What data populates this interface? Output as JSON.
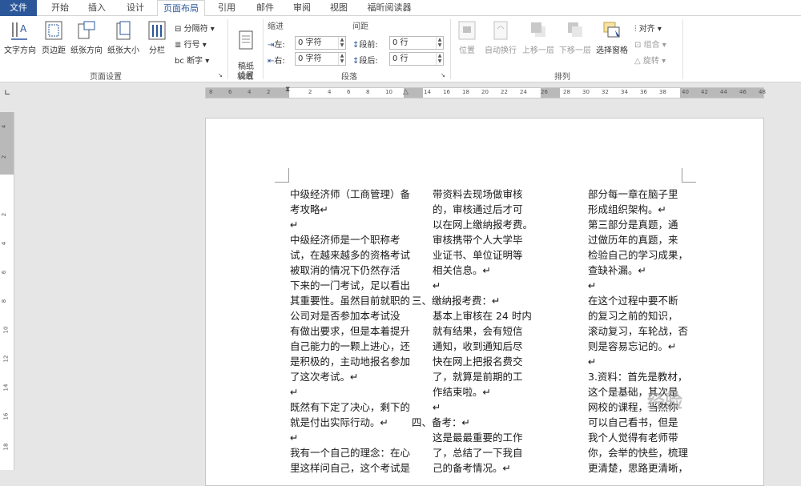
{
  "tabs": [
    "文件",
    "开始",
    "插入",
    "设计",
    "页面布局",
    "引用",
    "邮件",
    "审阅",
    "视图",
    "福昕阅读器"
  ],
  "ribbon": {
    "page_setup": {
      "text_direction": "文字方向",
      "margins": "页边距",
      "orientation": "纸张方向",
      "size": "纸张大小",
      "columns": "分栏",
      "breaks": "分隔符",
      "line_numbers": "行号",
      "hyphenation": "断字",
      "group_label": "页面设置"
    },
    "manuscript": {
      "label": "稿纸\n设置",
      "group_label": "稿纸"
    },
    "paragraph": {
      "indent_title": "缩进",
      "spacing_title": "间距",
      "left_label": "左:",
      "left_value": "0 字符",
      "right_label": "右:",
      "right_value": "0 字符",
      "before_label": "段前:",
      "before_value": "0 行",
      "after_label": "段后:",
      "after_value": "0 行",
      "group_label": "段落"
    },
    "arrange": {
      "position": "位置",
      "wrap_text": "自动换行",
      "bring_forward": "上移一层",
      "send_backward": "下移一层",
      "selection_pane": "选择窗格",
      "align": "对齐",
      "group": "组合",
      "rotate": "旋转",
      "group_label": "排列"
    }
  },
  "ruler_ticks": [
    "8",
    "6",
    "4",
    "2",
    "2",
    "4",
    "6",
    "8",
    "10",
    "14",
    "16",
    "18",
    "20",
    "22",
    "24",
    "26",
    "28",
    "30",
    "32",
    "34",
    "36",
    "38",
    "40",
    "42",
    "44",
    "46",
    "48"
  ],
  "vruler_ticks": [
    "4",
    "2",
    "2",
    "4",
    "6",
    "8",
    "10",
    "12",
    "14",
    "16",
    "18"
  ],
  "document": {
    "col1": [
      "中级经济师（工商管理）备",
      "考攻略↵",
      "↵",
      "中级经济师是一个职称考",
      "试，在越来越多的资格考试",
      "被取消的情况下仍然存活",
      "下来的一门考试，足以看出",
      "其重要性。虽然目前就职的",
      "公司对是否参加本考试没",
      "有做出要求，但是本着提升",
      "自己能力的一颗上进心，还",
      "是积极的，主动地报名参加",
      "了这次考试。↵",
      "↵",
      "既然有下定了决心，剩下的",
      "就是付出实际行动。↵",
      "↵",
      "我有一个自己的理念：在心",
      "里这样问自己，这个考试是"
    ],
    "col2": [
      "带资料去现场做审核",
      "的，审核通过后才可",
      "以在网上缴纳报考费。",
      "审核携带个人大学毕",
      "业证书、单位证明等",
      "相关信息。↵",
      "↵",
      "三、缴纳报考费：↵",
      "基本上审核在 24 时内",
      "就有结果，会有短信",
      "通知，收到通知后尽",
      "快在网上把报名费交",
      "了，就算是前期的工",
      "作结束啦。↵",
      "↵",
      "四、备考：↵",
      "这是最最重要的工作",
      "了，总结了一下我自",
      "己的备考情况。↵"
    ],
    "col3": [
      "部分每一章在脑子里",
      "形成组织架构。↵",
      "第三部分是真题，通",
      "过做历年的真题，来",
      "检验自己的学习成果，",
      "查缺补漏。↵",
      "↵",
      "在这个过程中要不断",
      "的复习之前的知识，",
      "滚动复习，车轮战，否",
      "则是容易忘记的。↵",
      "↵",
      "3.资料：首先是教材，",
      "这个是基础，其次是",
      "网校的课程，当然你",
      "可以自己看书，但是",
      "我个人觉得有老师带",
      "你，会举的快些，梳理",
      "更清楚，思路更清晰，"
    ]
  },
  "watermark": "经验"
}
